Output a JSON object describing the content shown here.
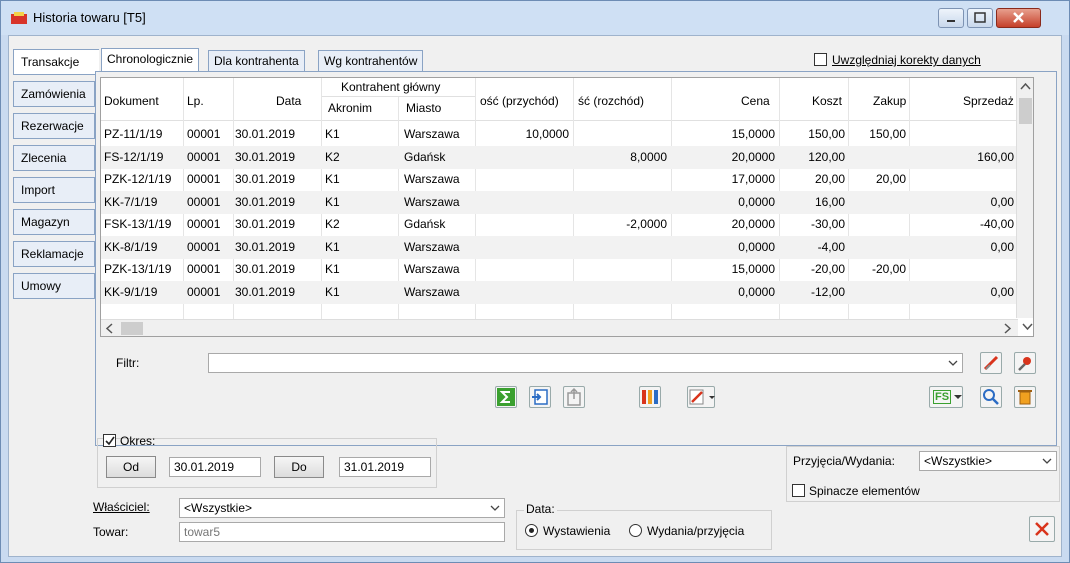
{
  "window": {
    "title": "Historia towaru [T5]"
  },
  "side_tabs": [
    "Transakcje",
    "Zamówienia",
    "Rezerwacje",
    "Zlecenia",
    "Import",
    "Magazyn",
    "Reklamacje",
    "Umowy"
  ],
  "top_tabs": [
    "Chronologicznie",
    "Dla kontrahenta",
    "Wg kontrahentów"
  ],
  "korekty_label": "Uwzględniaj korekty danych",
  "grid": {
    "headers": {
      "dokument": "Dokument",
      "lp": "Lp.",
      "data": "Data",
      "kontrahent_group": "Kontrahent główny",
      "akronim": "Akronim",
      "miasto": "Miasto",
      "przychod": "ość (przychód)",
      "rozchod": "ść (rozchód)",
      "cena": "Cena",
      "koszt": "Koszt",
      "zakup": "Zakup",
      "sprzedaz": "Sprzedaż"
    },
    "rows": [
      {
        "dok": "PZ-11/1/19",
        "lp": "00001",
        "data": "30.01.2019",
        "akr": "K1",
        "miasto": "Warszawa",
        "prz": "10,0000",
        "roz": "",
        "cena": "15,0000",
        "koszt": "150,00",
        "zakup": "150,00",
        "sprz": ""
      },
      {
        "dok": "FS-12/1/19",
        "lp": "00001",
        "data": "30.01.2019",
        "akr": "K2",
        "miasto": "Gdańsk",
        "prz": "",
        "roz": "8,0000",
        "cena": "20,0000",
        "koszt": "120,00",
        "zakup": "",
        "sprz": "160,00"
      },
      {
        "dok": "PZK-12/1/19",
        "lp": "00001",
        "data": "30.01.2019",
        "akr": "K1",
        "miasto": "Warszawa",
        "prz": "",
        "roz": "",
        "cena": "17,0000",
        "koszt": "20,00",
        "zakup": "20,00",
        "sprz": ""
      },
      {
        "dok": "KK-7/1/19",
        "lp": "00001",
        "data": "30.01.2019",
        "akr": "K1",
        "miasto": "Warszawa",
        "prz": "",
        "roz": "",
        "cena": "0,0000",
        "koszt": "16,00",
        "zakup": "",
        "sprz": "0,00"
      },
      {
        "dok": "FSK-13/1/19",
        "lp": "00001",
        "data": "30.01.2019",
        "akr": "K2",
        "miasto": "Gdańsk",
        "prz": "",
        "roz": "-2,0000",
        "cena": "20,0000",
        "koszt": "-30,00",
        "zakup": "",
        "sprz": "-40,00"
      },
      {
        "dok": "KK-8/1/19",
        "lp": "00001",
        "data": "30.01.2019",
        "akr": "K1",
        "miasto": "Warszawa",
        "prz": "",
        "roz": "",
        "cena": "0,0000",
        "koszt": "-4,00",
        "zakup": "",
        "sprz": "0,00"
      },
      {
        "dok": "PZK-13/1/19",
        "lp": "00001",
        "data": "30.01.2019",
        "akr": "K1",
        "miasto": "Warszawa",
        "prz": "",
        "roz": "",
        "cena": "15,0000",
        "koszt": "-20,00",
        "zakup": "-20,00",
        "sprz": ""
      },
      {
        "dok": "KK-9/1/19",
        "lp": "00001",
        "data": "30.01.2019",
        "akr": "K1",
        "miasto": "Warszawa",
        "prz": "",
        "roz": "",
        "cena": "0,0000",
        "koszt": "-12,00",
        "zakup": "",
        "sprz": "0,00"
      }
    ]
  },
  "filter_label": "Filtr:",
  "fs_label": "FS",
  "okres": {
    "label": "Okres:",
    "od_btn": "Od",
    "od_value": "30.01.2019",
    "do_btn": "Do",
    "do_value": "31.01.2019"
  },
  "przyjecia": {
    "label": "Przyjęcia/Wydania:",
    "value": "<Wszystkie>"
  },
  "spinacze_label": "Spinacze elementów",
  "wlasciciel": {
    "label": "Właściciel:",
    "value": "<Wszystkie>"
  },
  "towar": {
    "label": "Towar:",
    "value": "towar5"
  },
  "data_group": {
    "label": "Data:",
    "opt1": "Wystawienia",
    "opt2": "Wydania/przyjęcia"
  },
  "colors": {
    "accent": "#2b6cc4",
    "close_red": "#d9341c"
  }
}
